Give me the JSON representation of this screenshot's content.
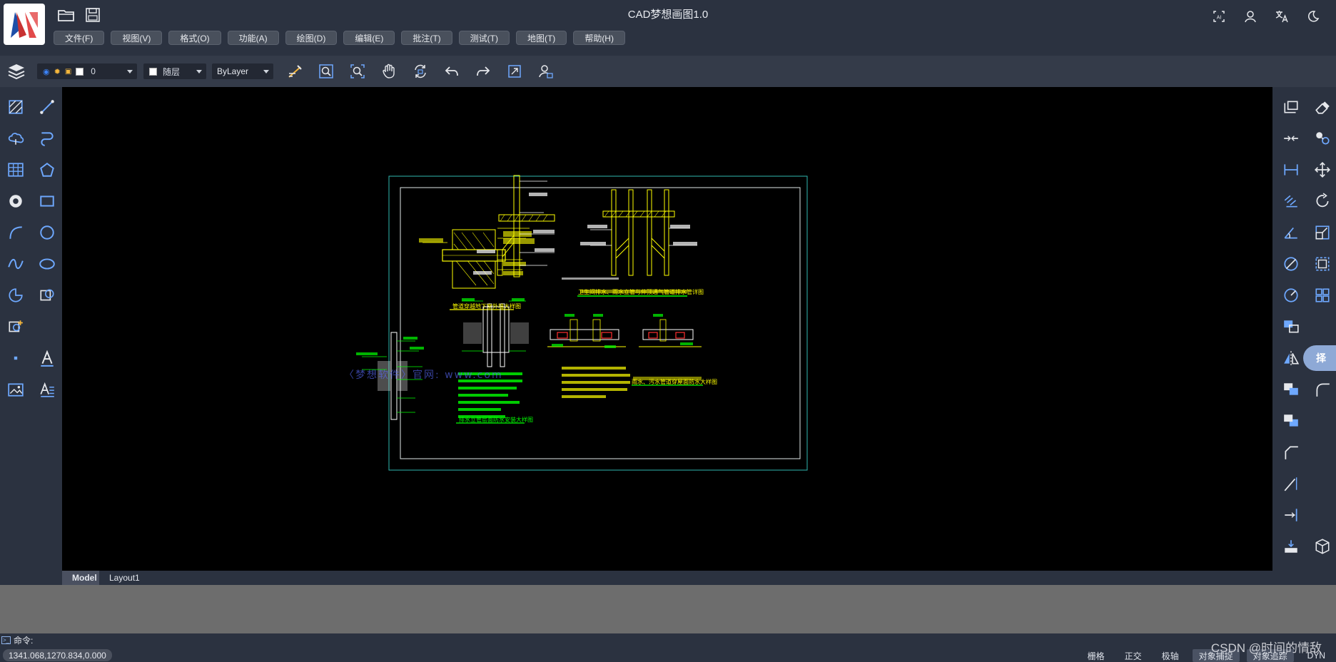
{
  "app": {
    "title": "CAD梦想画图1.0"
  },
  "menu": [
    "文件(F)",
    "视图(V)",
    "格式(O)",
    "功能(A)",
    "绘图(D)",
    "编辑(E)",
    "批注(T)",
    "测试(T)",
    "地图(T)",
    "帮助(H)"
  ],
  "top_right_icons": [
    "ai-icon",
    "user-icon",
    "translate-icon",
    "dark-mode-icon"
  ],
  "toolbar": {
    "layer_value": "0",
    "color_value": "随层",
    "linetype_value": "ByLayer",
    "tools": [
      "match-properties-icon",
      "zoom-window-icon",
      "zoom-extents-icon",
      "pan-icon",
      "regen-icon",
      "undo-icon",
      "redo-icon",
      "maximize-icon",
      "user-settings-icon"
    ]
  },
  "left_tools": [
    "hatch-icon",
    "line-icon",
    "revision-cloud-icon",
    "polyline-icon",
    "table-icon",
    "polygon-icon",
    "donut-icon",
    "rectangle-icon",
    "arc-icon",
    "circle-icon",
    "spline-icon",
    "ellipse-icon",
    "ellipse-arc-icon",
    "insert-block-icon",
    "create-block-icon",
    "point-icon",
    "text-icon",
    "image-icon",
    "mtext-icon"
  ],
  "right_tools": [
    "copy-icon",
    "erase-icon",
    "break-icon",
    "group-icon",
    "dimension-icon",
    "move-icon",
    "angle-dimension-icon",
    "rotate-icon",
    "angle-icon",
    "scale-icon",
    "diameter-icon",
    "selection-icon",
    "radius-icon",
    "array-icon",
    "layer-bring-icon",
    "mirror-icon",
    "layer-send-icon",
    "layer-front-icon",
    "fillet-icon",
    "layer-back-icon",
    "chamfer-icon",
    "extend-icon",
    "trim-icon",
    "stretch-icon",
    "3d-view-icon"
  ],
  "right_active": {
    "label": "择",
    "name": "select-tab"
  },
  "drawing": {
    "titles": [
      "管道穿越地下室外墙大样图",
      "卫生间排水、雨水立管与伸顶通气管道排水管详图",
      "排水立管层面防水安装大样图",
      "雨水、污水管道穿屋面防水大样图"
    ],
    "watermark_text": "〈梦想软件〉官网: www.com"
  },
  "tabs": [
    {
      "label": "Model",
      "active": true
    },
    {
      "label": "Layout1",
      "active": false
    }
  ],
  "command": {
    "prompt": "命令:"
  },
  "status": {
    "coords": "1341.068,1270.834,0.000",
    "buttons": [
      {
        "label": "栅格",
        "on": false
      },
      {
        "label": "正交",
        "on": false
      },
      {
        "label": "极轴",
        "on": false
      },
      {
        "label": "对象捕捉",
        "on": true
      },
      {
        "label": "对象追踪",
        "on": true
      },
      {
        "label": "DYN",
        "on": false
      }
    ]
  },
  "watermark": "CSDN @时间的情敌",
  "colors": {
    "accent": "#8ea9d6",
    "background": "#2b3240",
    "canvas": "#000000",
    "drawing_yellow": "#ffff00",
    "drawing_green": "#00ff00"
  }
}
